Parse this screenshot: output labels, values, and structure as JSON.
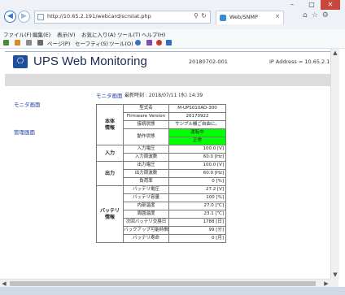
{
  "browser": {
    "url": "http://10.65.2.191/webcard/scrstat.php",
    "tab_title": "Web/SNMP",
    "search_glyph": "⚲",
    "refresh_glyph": "↻",
    "tab_close": "×",
    "minimize": "–",
    "maximize": "□",
    "close": "✕",
    "right_icons": "⌂☆⚙",
    "menu": [
      "ファイル(F)",
      "編集(E)",
      "表示(V)",
      "お気に入り(A)",
      "ツール(T)",
      "ヘルプ(H)"
    ],
    "toolbar": [
      "ページ(P)",
      "セーフティ(S)",
      "ツール(O)"
    ]
  },
  "header": {
    "logo_glyph": "⎔",
    "title": "UPS Web Monitoring",
    "id": "20180702-001",
    "ip": "IP Address = 10.65.2.191"
  },
  "sidebar": {
    "monitor": "モニタ画面",
    "admin": "管理画面"
  },
  "page": {
    "heading": "モニタ画面",
    "date": "最新時刻 : 2018/07/11 (水) 14:39"
  },
  "groups": {
    "main": "本体\n情報",
    "input": "入力",
    "output": "出力",
    "battery": "バッテリ\n情報"
  },
  "rows": {
    "model": {
      "label": "型式名",
      "value": "M-UPS010AD-300"
    },
    "firmware": {
      "label": "Firmware Version",
      "value": "20170922"
    },
    "comm": {
      "label": "接続状態",
      "value": "サンプル機ご自由に。"
    },
    "op": {
      "label": "動作状態",
      "value1": "運転中",
      "value2": "正常"
    },
    "in_v": {
      "label": "入力電圧",
      "value": "100.0 [V]"
    },
    "in_f": {
      "label": "入力周波数",
      "value": "60.0 [Hz]"
    },
    "out_v": {
      "label": "出力電圧",
      "value": "100.0 [V]"
    },
    "out_f": {
      "label": "出力周波数",
      "value": "60.0 [Hz]"
    },
    "load": {
      "label": "負荷率",
      "value": "0 [%]"
    },
    "bat_v": {
      "label": "バッテリ電圧",
      "value": "27.2 [V]"
    },
    "bat_cap": {
      "label": "バッテリ容量",
      "value": "100 [%]"
    },
    "temp": {
      "label": "内部温度",
      "value": "27.0 [℃]"
    },
    "amb": {
      "label": "周囲温度",
      "value": "23.1 [℃]"
    },
    "replace": {
      "label": "次回バッテリ交換日",
      "value": "1788 [日]"
    },
    "backup": {
      "label": "バックアップ可能時間",
      "value": "99 [分]"
    },
    "life": {
      "label": "バッテリ寿命",
      "value": "0 [月]"
    }
  },
  "colors": {
    "status_ok": "#00ff00",
    "link": "#1f3fa6",
    "title": "#1a2a52"
  }
}
